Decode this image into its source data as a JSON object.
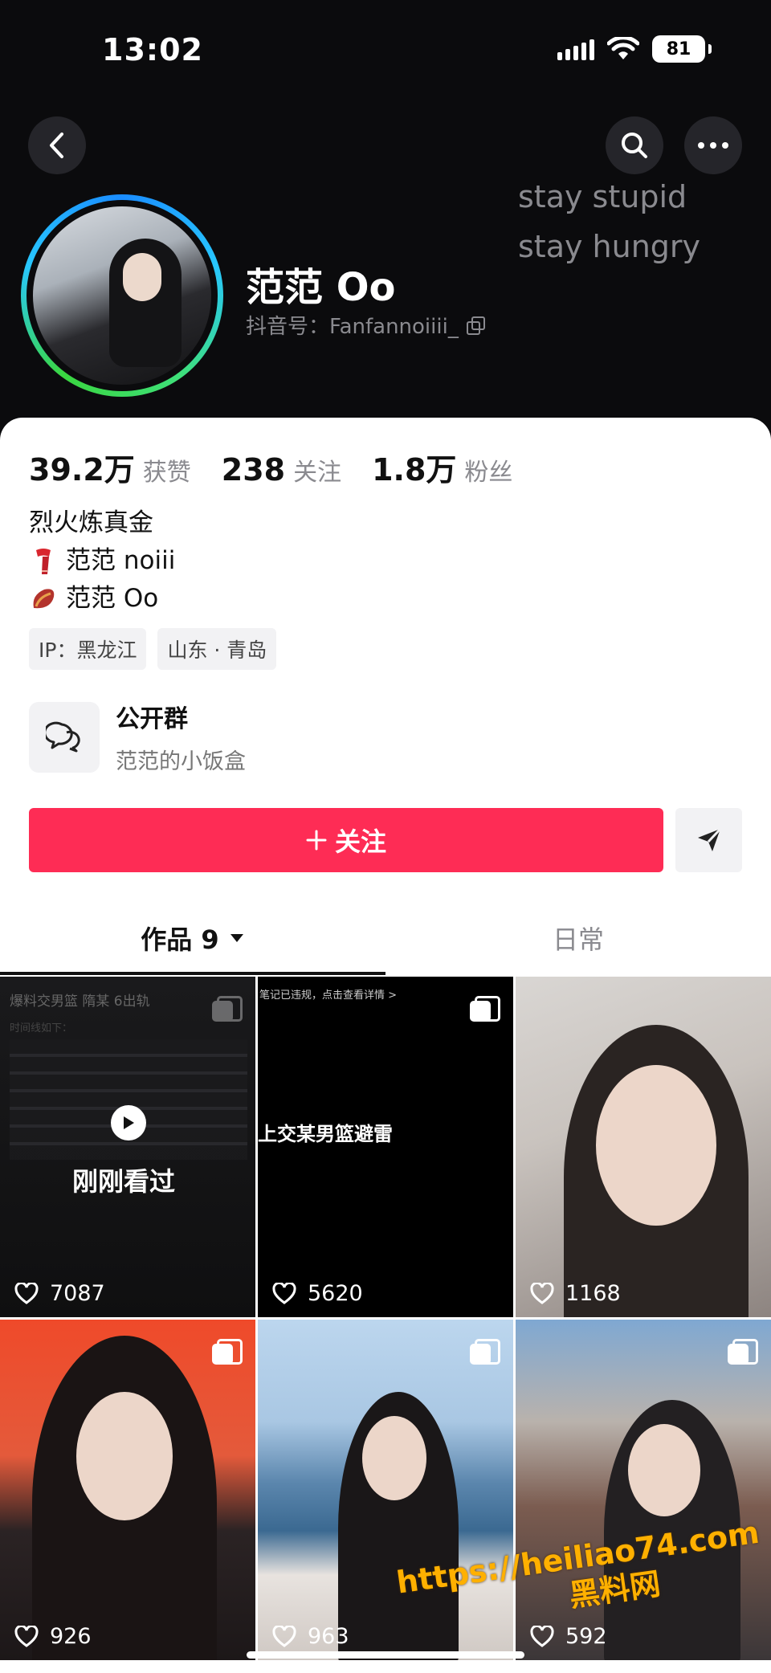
{
  "status_bar": {
    "time": "13:02",
    "battery": "81"
  },
  "profile": {
    "signature_line1": "stay stupid",
    "signature_line2": "stay hungry",
    "nickname": "范范 Oo",
    "douyin_id": "抖音号：Fanfannoiiii_"
  },
  "stats": [
    {
      "value": "39.2万",
      "label": "获赞"
    },
    {
      "value": "238",
      "label": "关注"
    },
    {
      "value": "1.8万",
      "label": "粉丝"
    }
  ],
  "bio": [
    {
      "icon": "scarf-emoji",
      "text": "烈火炼真金"
    },
    {
      "icon": "scarf-emoji",
      "text": "范范 noiii"
    },
    {
      "icon": "sweet-potato-emoji",
      "text": "范范 Oo"
    }
  ],
  "tags": [
    "IP：黑龙江",
    "山东 · 青岛"
  ],
  "group": {
    "title": "公开群",
    "subtitle": "范范的小饭盒"
  },
  "actions": {
    "follow_label": "关注"
  },
  "tabs": {
    "works_label": "作品 9",
    "daily_label": "日常"
  },
  "videos": [
    {
      "likes": "7087",
      "overlay": "刚刚看过",
      "title_text": "爆料交男篮 隋某 6出轨",
      "intro": "时间线如下："
    },
    {
      "likes": "5620",
      "top_note": "笔记已违规，点击查看详情 >",
      "headline": "上交某男篮避雷"
    },
    {
      "likes": "1168"
    },
    {
      "likes": "926"
    },
    {
      "likes": "963"
    },
    {
      "likes": "592"
    }
  ],
  "watermark": {
    "line1": "https://heiliao74.com",
    "line2": "黑料网"
  },
  "colors": {
    "accent": "#fe2c55",
    "background_dark": "#0b0b0d",
    "muted": "#8a8a8f"
  }
}
